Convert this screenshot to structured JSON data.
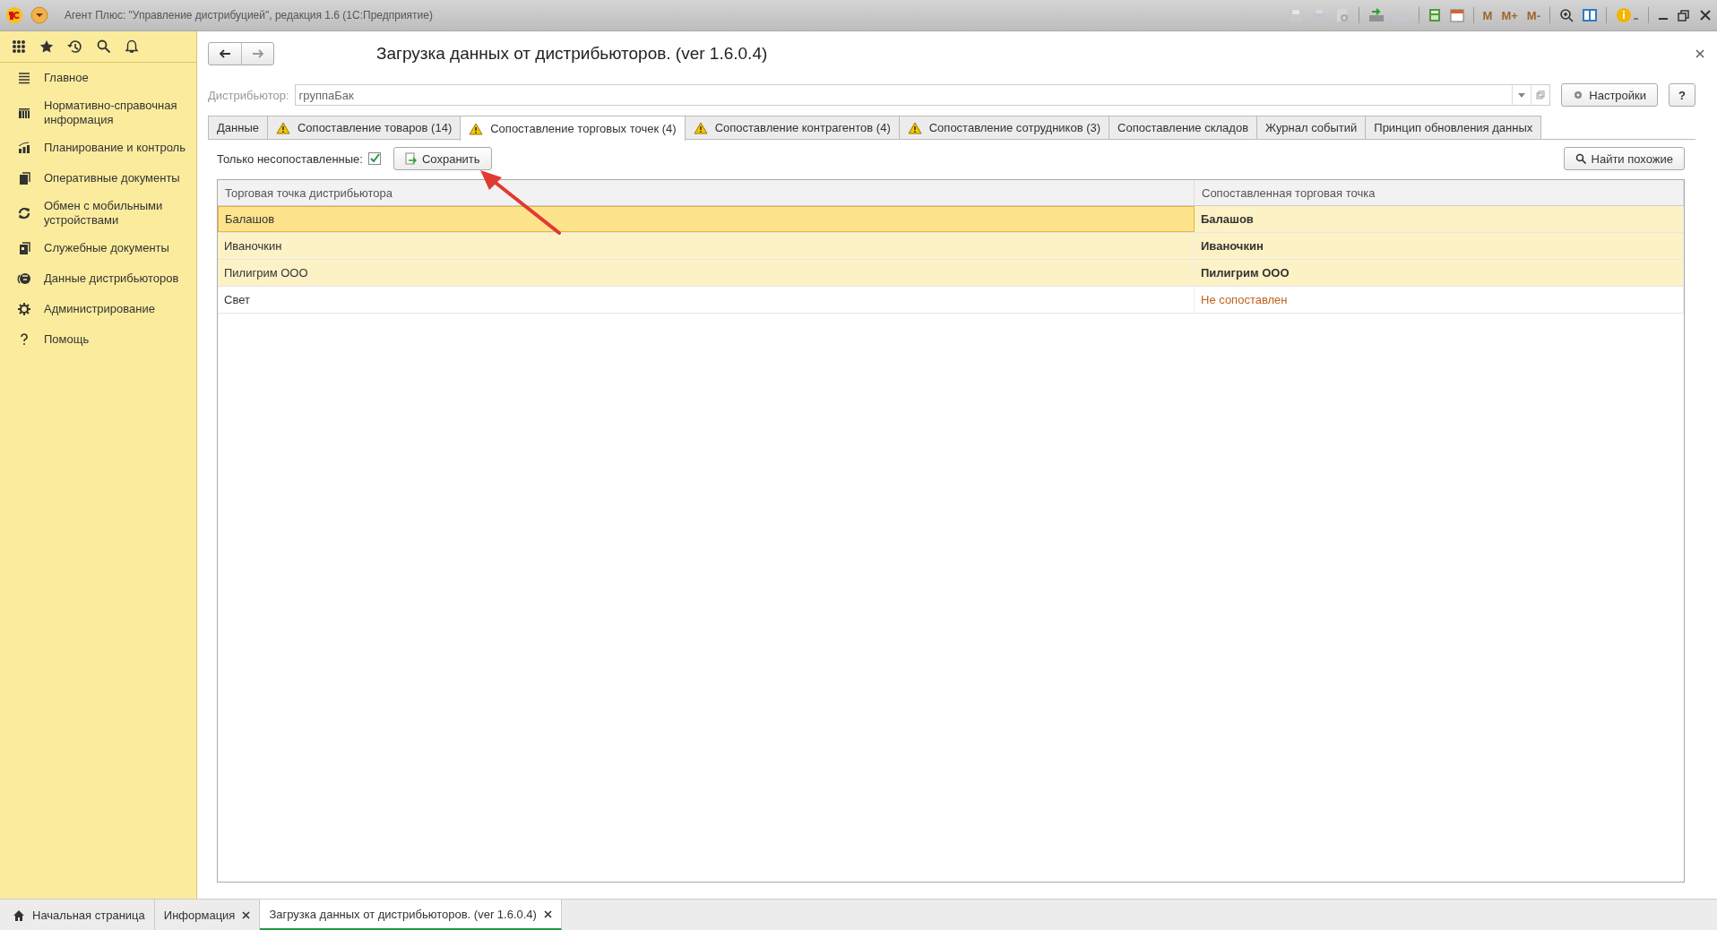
{
  "window": {
    "title": "Агент Плюс: \"Управление дистрибуцией\", редакция 1.6  (1С:Предприятие)",
    "memory_buttons": [
      "M",
      "M+",
      "M-"
    ]
  },
  "sidebar": {
    "items": [
      {
        "label": "Главное"
      },
      {
        "label": "Нормативно-справочная информация"
      },
      {
        "label": "Планирование и контроль"
      },
      {
        "label": "Оперативные документы"
      },
      {
        "label": "Обмен с мобильными устройствами"
      },
      {
        "label": "Служебные документы"
      },
      {
        "label": "Данные дистрибьюторов"
      },
      {
        "label": "Администрирование"
      },
      {
        "label": "Помощь"
      }
    ]
  },
  "form": {
    "title": "Загрузка данных от дистрибьюторов. (ver 1.6.0.4)",
    "distributor": {
      "label": "Дистрибьютор:",
      "value": "группаБак"
    },
    "settings_button": "Настройки",
    "help_button": "?"
  },
  "tabs": [
    {
      "label": "Данные",
      "warning": false,
      "selected": false
    },
    {
      "label": "Сопоставление товаров (14)",
      "warning": true,
      "selected": false
    },
    {
      "label": "Сопоставление торговых точек (4)",
      "warning": true,
      "selected": true
    },
    {
      "label": "Сопоставление контрагентов (4)",
      "warning": true,
      "selected": false
    },
    {
      "label": "Сопоставление сотрудников (3)",
      "warning": true,
      "selected": false
    },
    {
      "label": "Сопоставление складов",
      "warning": false,
      "selected": false
    },
    {
      "label": "Журнал событий",
      "warning": false,
      "selected": false
    },
    {
      "label": "Принцип обновления данных",
      "warning": false,
      "selected": false
    }
  ],
  "filter": {
    "label": "Только несопоставленные:",
    "checked": true
  },
  "save_button": "Сохранить",
  "find_button": "Найти похожие",
  "table": {
    "columns": [
      "Торговая точка дистрибьютора",
      "Сопоставленная торговая точка"
    ],
    "rows": [
      {
        "cells": [
          "Балашов",
          "Балашов"
        ],
        "matched": true,
        "selected": true
      },
      {
        "cells": [
          "Иваночкин",
          "Иваночкин"
        ],
        "matched": true,
        "selected": false
      },
      {
        "cells": [
          "Пилигрим ООО",
          "Пилигрим ООО"
        ],
        "matched": true,
        "selected": false
      },
      {
        "cells": [
          "Свет",
          "Не сопоставлен"
        ],
        "matched": false,
        "selected": false
      }
    ]
  },
  "annotation": {
    "kind": "arrow"
  },
  "window_tabs": [
    {
      "label": "Начальная страница",
      "kind": "home",
      "selected": false
    },
    {
      "label": "Информация",
      "kind": "closable",
      "selected": false
    },
    {
      "label": "Загрузка данных от дистрибьюторов. (ver 1.6.0.4)",
      "kind": "closable",
      "selected": true
    }
  ]
}
